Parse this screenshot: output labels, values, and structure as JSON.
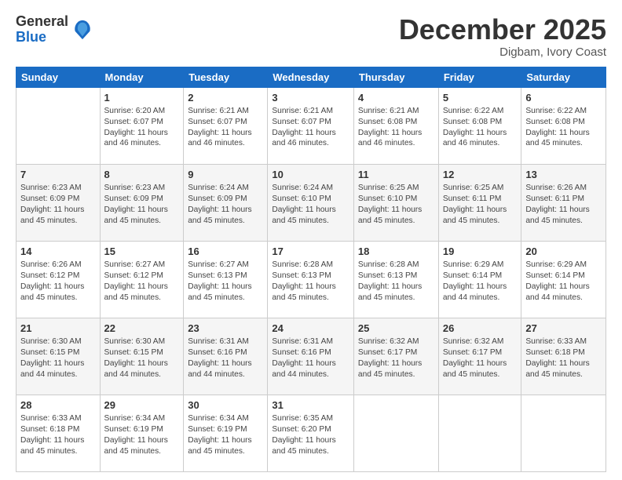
{
  "logo": {
    "general": "General",
    "blue": "Blue"
  },
  "header": {
    "month": "December 2025",
    "location": "Digbam, Ivory Coast"
  },
  "weekdays": [
    "Sunday",
    "Monday",
    "Tuesday",
    "Wednesday",
    "Thursday",
    "Friday",
    "Saturday"
  ],
  "weeks": [
    [
      {
        "day": "",
        "sunrise": "",
        "sunset": "",
        "daylight": ""
      },
      {
        "day": "1",
        "sunrise": "Sunrise: 6:20 AM",
        "sunset": "Sunset: 6:07 PM",
        "daylight": "Daylight: 11 hours and 46 minutes."
      },
      {
        "day": "2",
        "sunrise": "Sunrise: 6:21 AM",
        "sunset": "Sunset: 6:07 PM",
        "daylight": "Daylight: 11 hours and 46 minutes."
      },
      {
        "day": "3",
        "sunrise": "Sunrise: 6:21 AM",
        "sunset": "Sunset: 6:07 PM",
        "daylight": "Daylight: 11 hours and 46 minutes."
      },
      {
        "day": "4",
        "sunrise": "Sunrise: 6:21 AM",
        "sunset": "Sunset: 6:08 PM",
        "daylight": "Daylight: 11 hours and 46 minutes."
      },
      {
        "day": "5",
        "sunrise": "Sunrise: 6:22 AM",
        "sunset": "Sunset: 6:08 PM",
        "daylight": "Daylight: 11 hours and 46 minutes."
      },
      {
        "day": "6",
        "sunrise": "Sunrise: 6:22 AM",
        "sunset": "Sunset: 6:08 PM",
        "daylight": "Daylight: 11 hours and 45 minutes."
      }
    ],
    [
      {
        "day": "7",
        "sunrise": "Sunrise: 6:23 AM",
        "sunset": "Sunset: 6:09 PM",
        "daylight": "Daylight: 11 hours and 45 minutes."
      },
      {
        "day": "8",
        "sunrise": "Sunrise: 6:23 AM",
        "sunset": "Sunset: 6:09 PM",
        "daylight": "Daylight: 11 hours and 45 minutes."
      },
      {
        "day": "9",
        "sunrise": "Sunrise: 6:24 AM",
        "sunset": "Sunset: 6:09 PM",
        "daylight": "Daylight: 11 hours and 45 minutes."
      },
      {
        "day": "10",
        "sunrise": "Sunrise: 6:24 AM",
        "sunset": "Sunset: 6:10 PM",
        "daylight": "Daylight: 11 hours and 45 minutes."
      },
      {
        "day": "11",
        "sunrise": "Sunrise: 6:25 AM",
        "sunset": "Sunset: 6:10 PM",
        "daylight": "Daylight: 11 hours and 45 minutes."
      },
      {
        "day": "12",
        "sunrise": "Sunrise: 6:25 AM",
        "sunset": "Sunset: 6:11 PM",
        "daylight": "Daylight: 11 hours and 45 minutes."
      },
      {
        "day": "13",
        "sunrise": "Sunrise: 6:26 AM",
        "sunset": "Sunset: 6:11 PM",
        "daylight": "Daylight: 11 hours and 45 minutes."
      }
    ],
    [
      {
        "day": "14",
        "sunrise": "Sunrise: 6:26 AM",
        "sunset": "Sunset: 6:12 PM",
        "daylight": "Daylight: 11 hours and 45 minutes."
      },
      {
        "day": "15",
        "sunrise": "Sunrise: 6:27 AM",
        "sunset": "Sunset: 6:12 PM",
        "daylight": "Daylight: 11 hours and 45 minutes."
      },
      {
        "day": "16",
        "sunrise": "Sunrise: 6:27 AM",
        "sunset": "Sunset: 6:13 PM",
        "daylight": "Daylight: 11 hours and 45 minutes."
      },
      {
        "day": "17",
        "sunrise": "Sunrise: 6:28 AM",
        "sunset": "Sunset: 6:13 PM",
        "daylight": "Daylight: 11 hours and 45 minutes."
      },
      {
        "day": "18",
        "sunrise": "Sunrise: 6:28 AM",
        "sunset": "Sunset: 6:13 PM",
        "daylight": "Daylight: 11 hours and 45 minutes."
      },
      {
        "day": "19",
        "sunrise": "Sunrise: 6:29 AM",
        "sunset": "Sunset: 6:14 PM",
        "daylight": "Daylight: 11 hours and 44 minutes."
      },
      {
        "day": "20",
        "sunrise": "Sunrise: 6:29 AM",
        "sunset": "Sunset: 6:14 PM",
        "daylight": "Daylight: 11 hours and 44 minutes."
      }
    ],
    [
      {
        "day": "21",
        "sunrise": "Sunrise: 6:30 AM",
        "sunset": "Sunset: 6:15 PM",
        "daylight": "Daylight: 11 hours and 44 minutes."
      },
      {
        "day": "22",
        "sunrise": "Sunrise: 6:30 AM",
        "sunset": "Sunset: 6:15 PM",
        "daylight": "Daylight: 11 hours and 44 minutes."
      },
      {
        "day": "23",
        "sunrise": "Sunrise: 6:31 AM",
        "sunset": "Sunset: 6:16 PM",
        "daylight": "Daylight: 11 hours and 44 minutes."
      },
      {
        "day": "24",
        "sunrise": "Sunrise: 6:31 AM",
        "sunset": "Sunset: 6:16 PM",
        "daylight": "Daylight: 11 hours and 44 minutes."
      },
      {
        "day": "25",
        "sunrise": "Sunrise: 6:32 AM",
        "sunset": "Sunset: 6:17 PM",
        "daylight": "Daylight: 11 hours and 45 minutes."
      },
      {
        "day": "26",
        "sunrise": "Sunrise: 6:32 AM",
        "sunset": "Sunset: 6:17 PM",
        "daylight": "Daylight: 11 hours and 45 minutes."
      },
      {
        "day": "27",
        "sunrise": "Sunrise: 6:33 AM",
        "sunset": "Sunset: 6:18 PM",
        "daylight": "Daylight: 11 hours and 45 minutes."
      }
    ],
    [
      {
        "day": "28",
        "sunrise": "Sunrise: 6:33 AM",
        "sunset": "Sunset: 6:18 PM",
        "daylight": "Daylight: 11 hours and 45 minutes."
      },
      {
        "day": "29",
        "sunrise": "Sunrise: 6:34 AM",
        "sunset": "Sunset: 6:19 PM",
        "daylight": "Daylight: 11 hours and 45 minutes."
      },
      {
        "day": "30",
        "sunrise": "Sunrise: 6:34 AM",
        "sunset": "Sunset: 6:19 PM",
        "daylight": "Daylight: 11 hours and 45 minutes."
      },
      {
        "day": "31",
        "sunrise": "Sunrise: 6:35 AM",
        "sunset": "Sunset: 6:20 PM",
        "daylight": "Daylight: 11 hours and 45 minutes."
      },
      {
        "day": "",
        "sunrise": "",
        "sunset": "",
        "daylight": ""
      },
      {
        "day": "",
        "sunrise": "",
        "sunset": "",
        "daylight": ""
      },
      {
        "day": "",
        "sunrise": "",
        "sunset": "",
        "daylight": ""
      }
    ]
  ]
}
